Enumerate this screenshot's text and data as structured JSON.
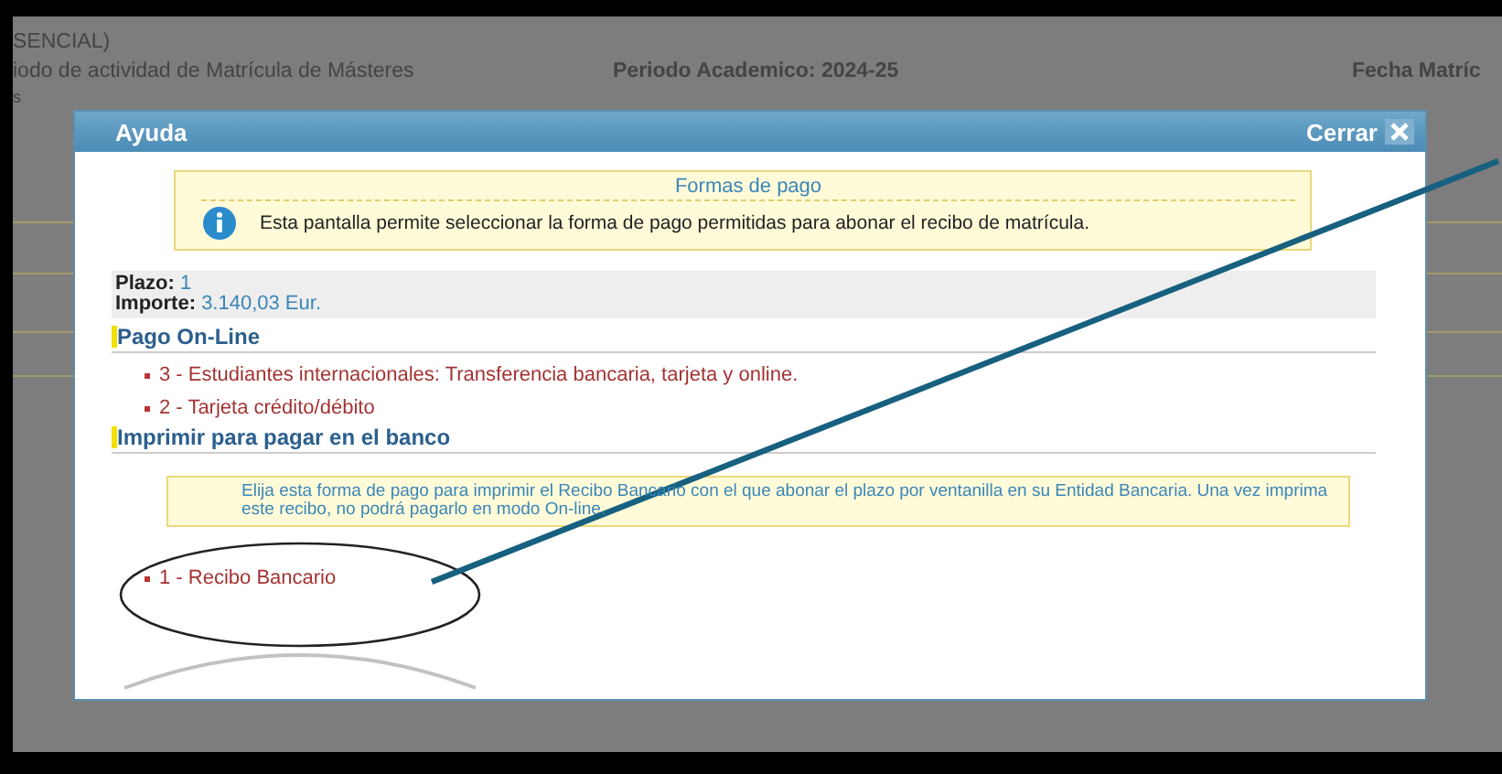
{
  "page": {
    "lines": [
      "SENCIAL)",
      "iodo de actividad de Matrícula de Másteres",
      "s"
    ],
    "period": "Periodo Academico: 2024-25",
    "date_label": "Fecha Matríc"
  },
  "dialog": {
    "title": "Ayuda",
    "close_label": "Cerrar",
    "info_box": {
      "title": "Formas de pago",
      "text": "Esta pantalla permite seleccionar la forma de pago permitidas para abonar el recibo de matrícula."
    },
    "summary": [
      {
        "label": "Plazo:",
        "value": "1"
      },
      {
        "label": "Importe:",
        "value": "3.140,03 Eur."
      }
    ],
    "sections": [
      {
        "title": "Pago On-Line",
        "options": [
          "3 - Estudiantes internacionales: Transferencia bancaria, tarjeta y online.",
          "2 - Tarjeta crédito/débito"
        ]
      },
      {
        "title": "Imprimir para pagar en el banco",
        "note": "Elija esta forma de pago para imprimir el Recibo Bancario con el que abonar el plazo por ventanilla en su Entidad Bancaria. Una vez imprima este recibo, no podrá pagarlo en modo On-line.",
        "options": [
          "1 - Recibo Bancario"
        ]
      }
    ]
  }
}
